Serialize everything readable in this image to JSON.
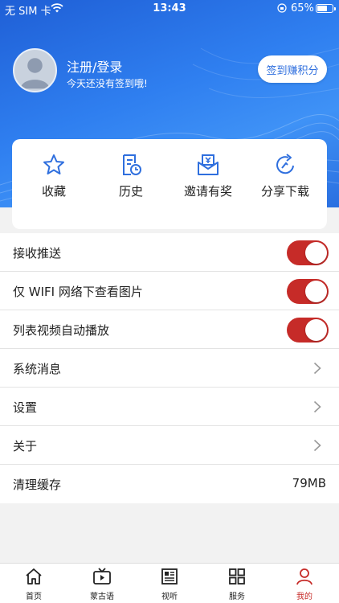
{
  "status_bar": {
    "carrier": "无 SIM 卡",
    "time": "13:43",
    "battery": "65%",
    "battery_level": 0.65
  },
  "profile": {
    "title": "注册/登录",
    "subtitle": "今天还没有签到哦!",
    "signin_button": "签到赚积分"
  },
  "quick_actions": [
    {
      "label": "收藏",
      "icon": "star-icon"
    },
    {
      "label": "历史",
      "icon": "history-icon"
    },
    {
      "label": "邀请有奖",
      "icon": "invite-icon"
    },
    {
      "label": "分享下载",
      "icon": "share-icon"
    }
  ],
  "settings": {
    "push": {
      "label": "接收推送",
      "on": true
    },
    "wifi_images": {
      "label": "仅 WIFI 网络下查看图片",
      "on": true
    },
    "autoplay": {
      "label": "列表视频自动播放",
      "on": true
    },
    "messages": {
      "label": "系统消息"
    },
    "settings": {
      "label": "设置"
    },
    "about": {
      "label": "关于"
    },
    "cache": {
      "label": "清理缓存",
      "value": "79MB"
    }
  },
  "tabs": [
    {
      "label": "首页",
      "icon": "home-icon"
    },
    {
      "label": "蒙古语",
      "icon": "tv-icon"
    },
    {
      "label": "视听",
      "icon": "newspaper-icon"
    },
    {
      "label": "服务",
      "icon": "grid-icon"
    },
    {
      "label": "我的",
      "icon": "user-icon",
      "active": true
    }
  ],
  "colors": {
    "accent": "#c62b28",
    "primary_blue": "#2f6fde"
  }
}
